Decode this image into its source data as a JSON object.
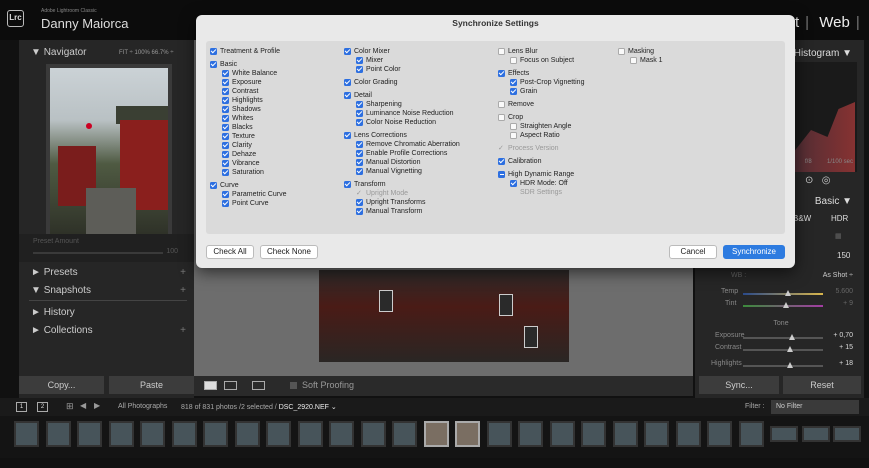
{
  "app": {
    "name": "Adobe Lightroom Classic",
    "user": "Danny Maiorca",
    "logo": "Lrc"
  },
  "modules": [
    "t",
    "Web"
  ],
  "left_panel": {
    "navigator": {
      "label": "Navigator",
      "zoom": "FIT ÷  100%  66.7% ÷"
    },
    "preset_amount": {
      "label": "Preset Amount",
      "value": "100"
    },
    "sections": [
      "Presets",
      "Snapshots",
      "History",
      "Collections"
    ],
    "copy_label": "Copy...",
    "paste_label": "Paste"
  },
  "toolbar": {
    "soft_proofing": "Soft Proofing"
  },
  "right_panel": {
    "histogram": "Histogram",
    "shutter": "1/100 sec",
    "shutter_prefix": "f/8",
    "basic": "Basic",
    "bw": "B&W",
    "hdr": "HDR",
    "amount": "150",
    "wb_label": "WB :",
    "wb_value": "As Shot ÷",
    "temp_label": "Temp",
    "temp_value": "5.600",
    "tint_label": "Tint",
    "tint_value": "+ 9",
    "tone_label": "Tone",
    "exposure_label": "Exposure",
    "exposure_value": "+ 0,70",
    "contrast_label": "Contrast",
    "contrast_value": "+ 15",
    "highlights_label": "Highlights",
    "highlights_value": "+ 18",
    "sync_label": "Sync...",
    "reset_label": "Reset"
  },
  "filmstrip": {
    "source": "All Photographs",
    "count": "818 of 831 photos /2 selected /",
    "filename": "DSC_2920.NEF ⌄",
    "filter_label": "Filter :",
    "filter_value": "No Filter",
    "page1": "1",
    "page2": "2"
  },
  "dialog": {
    "title": "Synchronize Settings",
    "check_all": "Check All",
    "check_none": "Check None",
    "cancel": "Cancel",
    "synchronize": "Synchronize",
    "col1": [
      {
        "label": "Treatment & Profile",
        "state": "on",
        "indent": 0
      },
      {
        "label": "Basic",
        "state": "on",
        "indent": 0,
        "gap": true
      },
      {
        "label": "White Balance",
        "state": "on",
        "indent": 1
      },
      {
        "label": "Exposure",
        "state": "on",
        "indent": 1
      },
      {
        "label": "Contrast",
        "state": "on",
        "indent": 1
      },
      {
        "label": "Highlights",
        "state": "on",
        "indent": 1
      },
      {
        "label": "Shadows",
        "state": "on",
        "indent": 1
      },
      {
        "label": "Whites",
        "state": "on",
        "indent": 1
      },
      {
        "label": "Blacks",
        "state": "on",
        "indent": 1
      },
      {
        "label": "Texture",
        "state": "on",
        "indent": 1
      },
      {
        "label": "Clarity",
        "state": "on",
        "indent": 1
      },
      {
        "label": "Dehaze",
        "state": "on",
        "indent": 1
      },
      {
        "label": "Vibrance",
        "state": "on",
        "indent": 1
      },
      {
        "label": "Saturation",
        "state": "on",
        "indent": 1
      },
      {
        "label": "Curve",
        "state": "on",
        "indent": 0,
        "gap": true
      },
      {
        "label": "Parametric Curve",
        "state": "on",
        "indent": 1
      },
      {
        "label": "Point Curve",
        "state": "on",
        "indent": 1
      }
    ],
    "col2": [
      {
        "label": "Color Mixer",
        "state": "on",
        "indent": 0
      },
      {
        "label": "Mixer",
        "state": "on",
        "indent": 1
      },
      {
        "label": "Point Color",
        "state": "on",
        "indent": 1
      },
      {
        "label": "Color Grading",
        "state": "on",
        "indent": 0,
        "gap": true
      },
      {
        "label": "Detail",
        "state": "on",
        "indent": 0,
        "gap": true
      },
      {
        "label": "Sharpening",
        "state": "on",
        "indent": 1
      },
      {
        "label": "Luminance Noise Reduction",
        "state": "on",
        "indent": 1
      },
      {
        "label": "Color Noise Reduction",
        "state": "on",
        "indent": 1
      },
      {
        "label": "Lens Corrections",
        "state": "on",
        "indent": 0,
        "gap": true
      },
      {
        "label": "Remove Chromatic Aberration",
        "state": "on",
        "indent": 1
      },
      {
        "label": "Enable Profile Corrections",
        "state": "on",
        "indent": 1
      },
      {
        "label": "Manual Distortion",
        "state": "on",
        "indent": 1
      },
      {
        "label": "Manual Vignetting",
        "state": "on",
        "indent": 1
      },
      {
        "label": "Transform",
        "state": "on",
        "indent": 0,
        "gap": true
      },
      {
        "label": "Upright Mode",
        "state": "disabled",
        "indent": 1
      },
      {
        "label": "Upright Transforms",
        "state": "on",
        "indent": 1
      },
      {
        "label": "Manual Transform",
        "state": "on",
        "indent": 1
      }
    ],
    "col3": [
      {
        "label": "Lens Blur",
        "state": "off",
        "indent": 0
      },
      {
        "label": "Focus on Subject",
        "state": "off",
        "indent": 1
      },
      {
        "label": "Effects",
        "state": "on",
        "indent": 0,
        "gap": true
      },
      {
        "label": "Post-Crop Vignetting",
        "state": "on",
        "indent": 1
      },
      {
        "label": "Grain",
        "state": "on",
        "indent": 1
      },
      {
        "label": "Remove",
        "state": "off",
        "indent": 0,
        "gap": true
      },
      {
        "label": "Crop",
        "state": "off",
        "indent": 0,
        "gap": true
      },
      {
        "label": "Straighten Angle",
        "state": "off",
        "indent": 1
      },
      {
        "label": "Aspect Ratio",
        "state": "off",
        "indent": 1
      },
      {
        "label": "Process Version",
        "state": "disabled",
        "indent": 0,
        "gap": true
      },
      {
        "label": "Calibration",
        "state": "on",
        "indent": 0,
        "gap": true
      },
      {
        "label": "High Dynamic Range",
        "state": "dash",
        "indent": 0,
        "gap": true
      },
      {
        "label": "HDR Mode: Off",
        "state": "on",
        "indent": 1
      },
      {
        "label": "SDR Settings",
        "state": "disabled-blank",
        "indent": 1
      }
    ],
    "col4": [
      {
        "label": "Masking",
        "state": "off",
        "indent": 0
      },
      {
        "label": "Mask 1",
        "state": "off",
        "indent": 1
      }
    ]
  }
}
